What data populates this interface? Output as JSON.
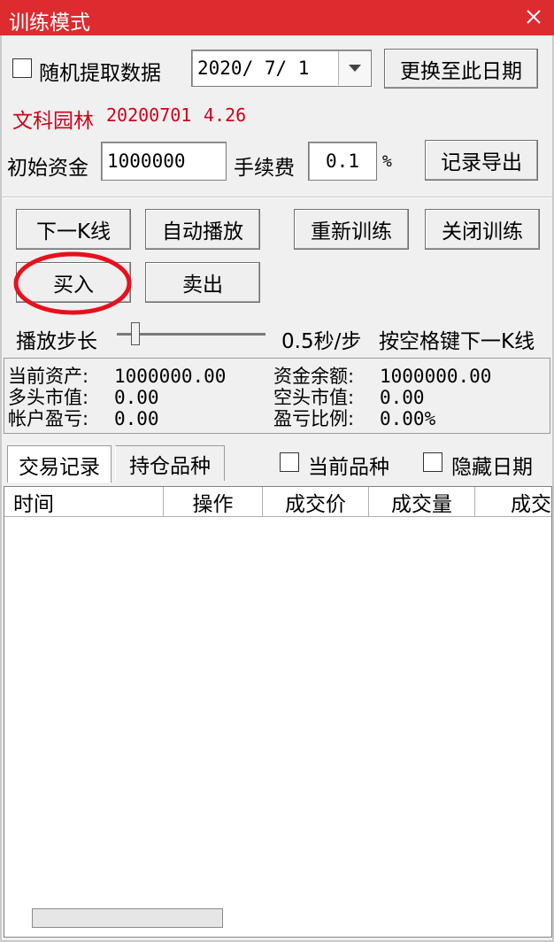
{
  "window": {
    "title": "训练模式",
    "titlebar_color": "#dd2b30"
  },
  "top_row": {
    "random_label": "随机提取数据",
    "random_checked": false,
    "date_value": "2020/ 7/ 1",
    "change_date_button": "更换至此日期"
  },
  "stock_info": {
    "name": "文科园林",
    "date": "20200701",
    "price": "4.26",
    "color": "#d0021b"
  },
  "capital": {
    "initial_label": "初始资金",
    "initial_value": "1000000",
    "fee_label": "手续费",
    "fee_value": "0.1",
    "fee_unit": "%",
    "export_button": "记录导出"
  },
  "controls": {
    "next_k": "下一K线",
    "auto_play": "自动播放",
    "restart": "重新训练",
    "close": "关闭训练",
    "buy": "买入",
    "sell": "卖出",
    "step_label": "播放步长",
    "step_value": "0.5秒/步",
    "hint": "按空格键下一K线"
  },
  "stats": {
    "current_assets_label": "当前资产:",
    "current_assets_value": "1000000.00",
    "balance_label": "资金余额:",
    "balance_value": "1000000.00",
    "long_value_label": "多头市值:",
    "long_value_value": "0.00",
    "short_value_label": "空头市值:",
    "short_value_value": "0.00",
    "pl_label": "帐户盈亏:",
    "pl_value": "0.00",
    "pl_ratio_label": "盈亏比例:",
    "pl_ratio_value": "0.00%"
  },
  "tabs": [
    {
      "label": "交易记录",
      "active": true
    },
    {
      "label": "持仓品种",
      "active": false
    }
  ],
  "filters": {
    "current_symbol": "当前品种",
    "hide_date": "隐藏日期"
  },
  "table": {
    "columns": [
      "时间",
      "操作",
      "成交价",
      "成交量",
      "成交"
    ]
  },
  "annotation": {
    "color": "#e8101c"
  }
}
